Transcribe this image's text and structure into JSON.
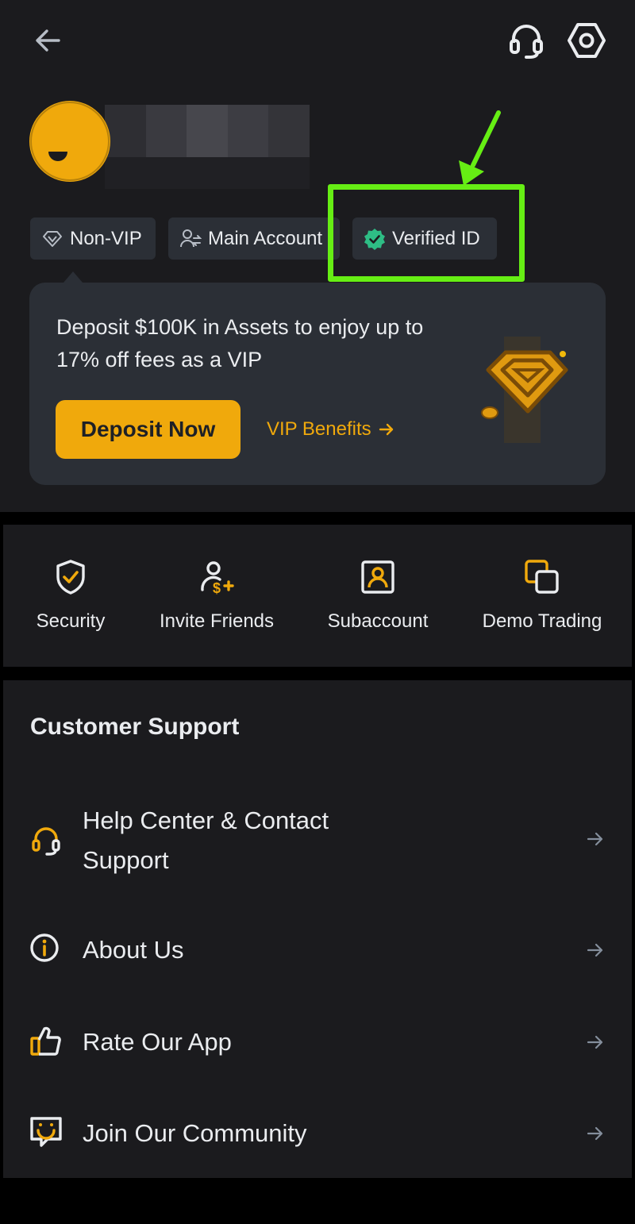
{
  "header": {
    "back_icon": "back-arrow-icon",
    "support_icon": "headset-icon",
    "settings_icon": "gear-hexagon-icon"
  },
  "profile": {
    "avatar_color": "#f0a90c"
  },
  "chips": {
    "vip_label": "Non-VIP",
    "account_label": "Main Account",
    "verified_label": "Verified ID",
    "verified_color": "#2ebd85"
  },
  "annotation": {
    "highlight_color": "#66ee14"
  },
  "vip_card": {
    "text": "Deposit $100K in Assets to enjoy up to 17% off fees as a VIP",
    "deposit_button": "Deposit Now",
    "benefits_link": "VIP Benefits",
    "accent_color": "#f0a90c"
  },
  "shortcuts": [
    {
      "label": "Security",
      "icon": "shield-check-icon"
    },
    {
      "label": "Invite Friends",
      "icon": "invite-friends-icon"
    },
    {
      "label": "Subaccount",
      "icon": "subaccount-icon"
    },
    {
      "label": "Demo Trading",
      "icon": "demo-trading-icon"
    }
  ],
  "support": {
    "title": "Customer Support",
    "items": [
      {
        "label": "Help Center & Contact Support",
        "icon": "headset-icon"
      },
      {
        "label": "About Us",
        "icon": "info-icon"
      },
      {
        "label": "Rate Our App",
        "icon": "thumbs-up-icon"
      },
      {
        "label": "Join Our Community",
        "icon": "chat-smile-icon"
      }
    ]
  }
}
